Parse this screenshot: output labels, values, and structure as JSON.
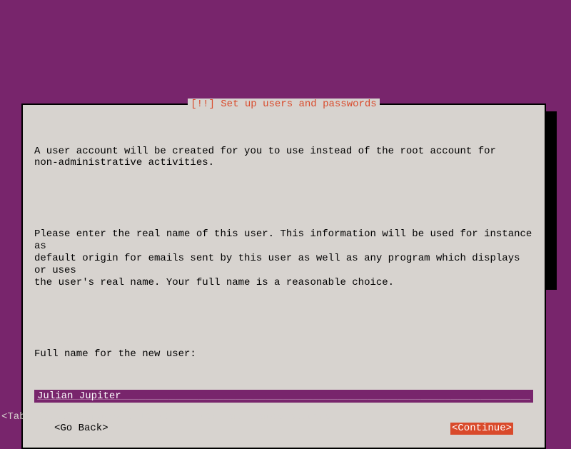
{
  "dialog": {
    "title": "[!!] Set up users and passwords",
    "paragraph1": "A user account will be created for you to use instead of the root account for\nnon-administrative activities.",
    "paragraph2": "Please enter the real name of this user. This information will be used for instance as\ndefault origin for emails sent by this user as well as any program which displays or uses\nthe user's real name. Your full name is a reasonable choice.",
    "prompt": "Full name for the new user:",
    "input_value": "Julian Jupiter",
    "back_label": "<Go Back>",
    "continue_label": "<Continue>"
  },
  "footer": {
    "hint": "<Tab> moves; <Space> selects; <Enter> activates buttons"
  }
}
